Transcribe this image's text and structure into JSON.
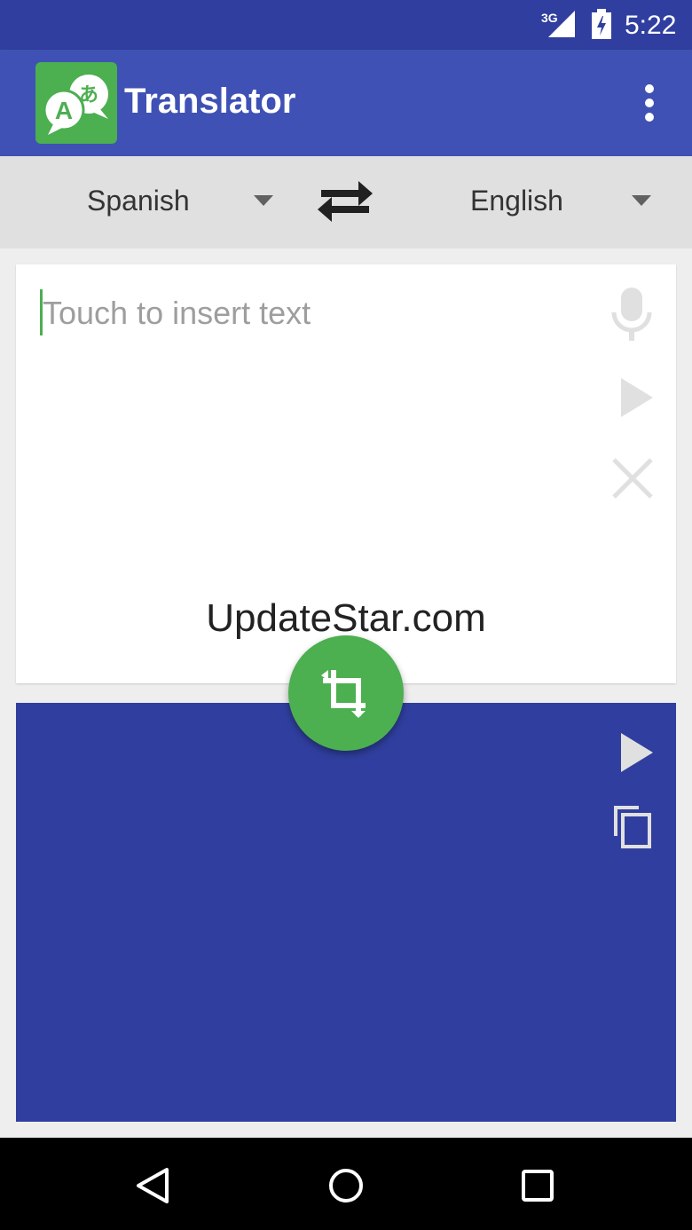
{
  "status_bar": {
    "network": "3G",
    "time": "5:22"
  },
  "app_bar": {
    "title": "Translator",
    "icon_glyphs": {
      "latin": "A",
      "japanese": "あ"
    }
  },
  "language_bar": {
    "source_language": "Spanish",
    "target_language": "English"
  },
  "input_card": {
    "placeholder": "Touch to insert text",
    "value": ""
  },
  "watermark": "UpdateStar.com",
  "colors": {
    "primary": "#3f51b5",
    "primary_dark": "#303f9f",
    "accent": "#4caf50"
  },
  "icons": {
    "overflow": "more-vert-icon",
    "swap": "swap-arrows-icon",
    "mic": "microphone-icon",
    "speak_input": "play-icon",
    "clear": "close-icon",
    "translate": "crop-rotate-icon",
    "speak_output": "play-icon",
    "copy": "copy-icon"
  }
}
